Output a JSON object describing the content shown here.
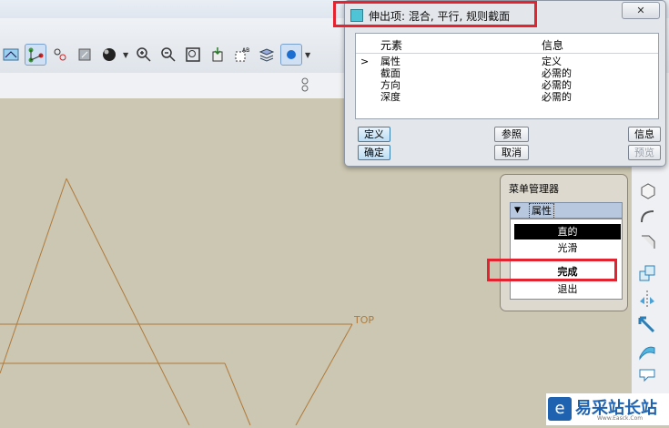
{
  "dialog": {
    "title": "伸出项: 混合, 平行, 规则截面",
    "close_glyph": "✕",
    "columns": {
      "element": "元素",
      "info": "信息"
    },
    "current_marker": ">",
    "rows": [
      {
        "element": "属性",
        "info": "定义"
      },
      {
        "element": "截面",
        "info": "必需的"
      },
      {
        "element": "方向",
        "info": "必需的"
      },
      {
        "element": "深度",
        "info": "必需的"
      }
    ],
    "buttons": {
      "define": "定义",
      "reference": "参照",
      "info": "信息",
      "ok": "确定",
      "cancel": "取消",
      "preview": "预览"
    }
  },
  "menu_manager": {
    "title": "菜单管理器",
    "section": "属性",
    "items": [
      "直的",
      "光滑",
      "完成",
      "退出"
    ],
    "selected": "直的"
  },
  "canvas": {
    "datum_label": "TOP"
  },
  "watermark": {
    "text": "易采站长站",
    "sub": "Www.Easck.Com"
  },
  "colors": {
    "highlight_box": "#e32430",
    "sketch_line": "#b07a3a"
  }
}
